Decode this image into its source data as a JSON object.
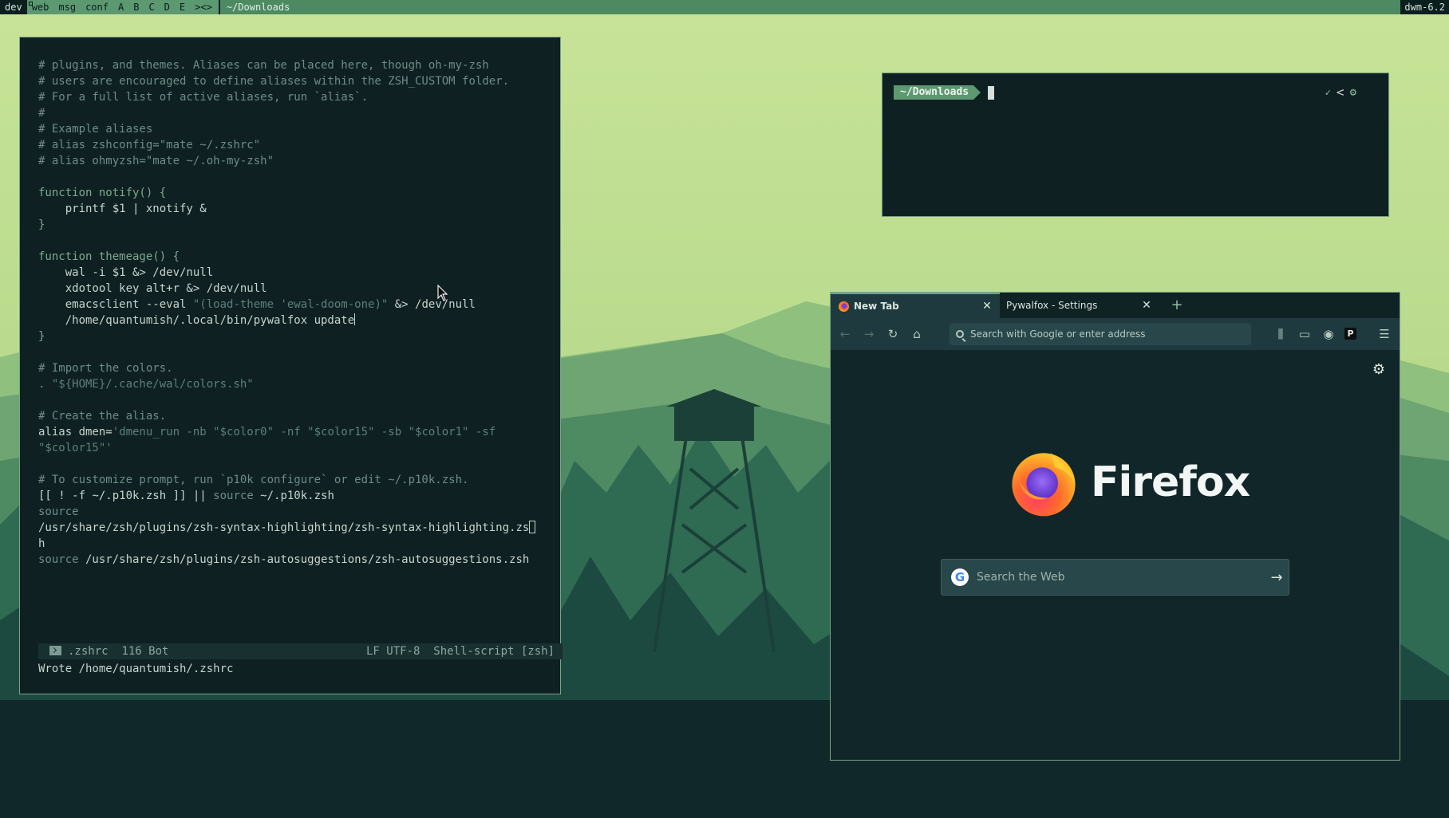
{
  "bar": {
    "tags": [
      {
        "label": "dev",
        "selected": true,
        "occupied": false
      },
      {
        "label": "web",
        "selected": false,
        "occupied": true
      },
      {
        "label": "msg",
        "selected": false,
        "occupied": false
      },
      {
        "label": "conf",
        "selected": false,
        "occupied": false
      },
      {
        "label": "A",
        "selected": false,
        "occupied": false
      },
      {
        "label": "B",
        "selected": false,
        "occupied": false
      },
      {
        "label": "C",
        "selected": false,
        "occupied": false
      },
      {
        "label": "D",
        "selected": false,
        "occupied": false
      },
      {
        "label": "E",
        "selected": false,
        "occupied": false
      }
    ],
    "layout_symbol": "><>",
    "window_title": "~/Downloads",
    "status": "dwm-6.2",
    "colors": {
      "bar": "#5c9970",
      "selected": "#0c1f1f"
    }
  },
  "editor": {
    "lines": [
      [
        [
          "cm",
          "# plugins, and themes. Aliases can be placed here, though oh-my-zsh"
        ]
      ],
      [
        [
          "cm",
          "# users are encouraged to define aliases within the ZSH_CUSTOM folder."
        ]
      ],
      [
        [
          "cm",
          "# For a full list of active aliases, run `alias`."
        ]
      ],
      [
        [
          "cm",
          "#"
        ]
      ],
      [
        [
          "cm",
          "# Example aliases"
        ]
      ],
      [
        [
          "cm",
          "# alias zshconfig=\"mate ~/.zshrc\""
        ]
      ],
      [
        [
          "cm",
          "# alias ohmyzsh=\"mate ~/.oh-my-zsh\""
        ]
      ],
      [],
      [
        [
          "kw",
          "function notify() {"
        ]
      ],
      [
        [
          "plain",
          "    printf $1 | xnotify &"
        ]
      ],
      [
        [
          "kw",
          "}"
        ]
      ],
      [],
      [
        [
          "kw",
          "function themeage() {"
        ]
      ],
      [
        [
          "plain",
          "    wal -i $1 &> /dev/null"
        ]
      ],
      [
        [
          "plain",
          "    xdotool key alt+r &> /dev/null"
        ]
      ],
      [
        [
          "plain",
          "    emacsclient --eval "
        ],
        [
          "st",
          "\"(load-theme 'ewal-doom-one)\""
        ],
        [
          "plain",
          " &> /dev/null"
        ]
      ],
      [
        [
          "plain",
          "    /home/quantumish/.local/bin/pywalfox update"
        ],
        [
          "caret",
          ""
        ]
      ],
      [
        [
          "kw",
          "}"
        ]
      ],
      [],
      [
        [
          "cm",
          "# Import the colors."
        ]
      ],
      [
        [
          "cm",
          ". "
        ],
        [
          "st",
          "\"${HOME}/.cache/wal/colors.sh\""
        ]
      ],
      [],
      [
        [
          "cm",
          "# Create the alias."
        ]
      ],
      [
        [
          "plain",
          "alias dmen="
        ],
        [
          "st",
          "'dmenu_run -nb \"$color0\" -nf \"$color15\" -sb \"$color1\" -sf"
        ]
      ],
      [
        [
          "st",
          "\"$color15\"'"
        ]
      ],
      [],
      [
        [
          "cm",
          "# To customize prompt, run `p10k configure` or edit ~/.p10k.zsh."
        ]
      ],
      [
        [
          "plain",
          "[[ ! -f ~/.p10k.zsh ]] || "
        ],
        [
          "cm",
          "source"
        ],
        [
          "plain",
          " ~/.p10k.zsh"
        ]
      ],
      [
        [
          "cm",
          "source"
        ]
      ],
      [
        [
          "plain",
          "/usr/share/zsh/plugins/zsh-syntax-highlighting/zsh-syntax-highlighting.zs"
        ],
        [
          "box",
          ""
        ]
      ],
      [
        [
          "plain",
          "h"
        ]
      ],
      [
        [
          "cm",
          "source"
        ],
        [
          "plain",
          " /usr/share/zsh/plugins/zsh-autosuggestions/zsh-autosuggestions.zsh"
        ]
      ]
    ],
    "modeline": {
      "filename": ".zshrc",
      "position": "116 Bot",
      "encoding": "LF UTF-8",
      "mode": "Shell-script [zsh]"
    },
    "echo_area": "Wrote /home/quantumish/.zshrc"
  },
  "terminal": {
    "prompt_dir": "~/Downloads",
    "status_check": "✓",
    "status_chevron": "<",
    "status_gear": "⚙"
  },
  "firefox": {
    "tabs": [
      {
        "title": "New Tab",
        "active": true
      },
      {
        "title": "Pywalfox - Settings",
        "active": false
      }
    ],
    "new_tab": "+",
    "url_placeholder": "Search with Google or enter address",
    "brand": "Firefox",
    "search_placeholder": "Search the Web",
    "search_engine_glyph": "G",
    "colors": {
      "toolbar": "#1e3a3e",
      "content": "#112628",
      "accent": "#6fa57f"
    }
  }
}
